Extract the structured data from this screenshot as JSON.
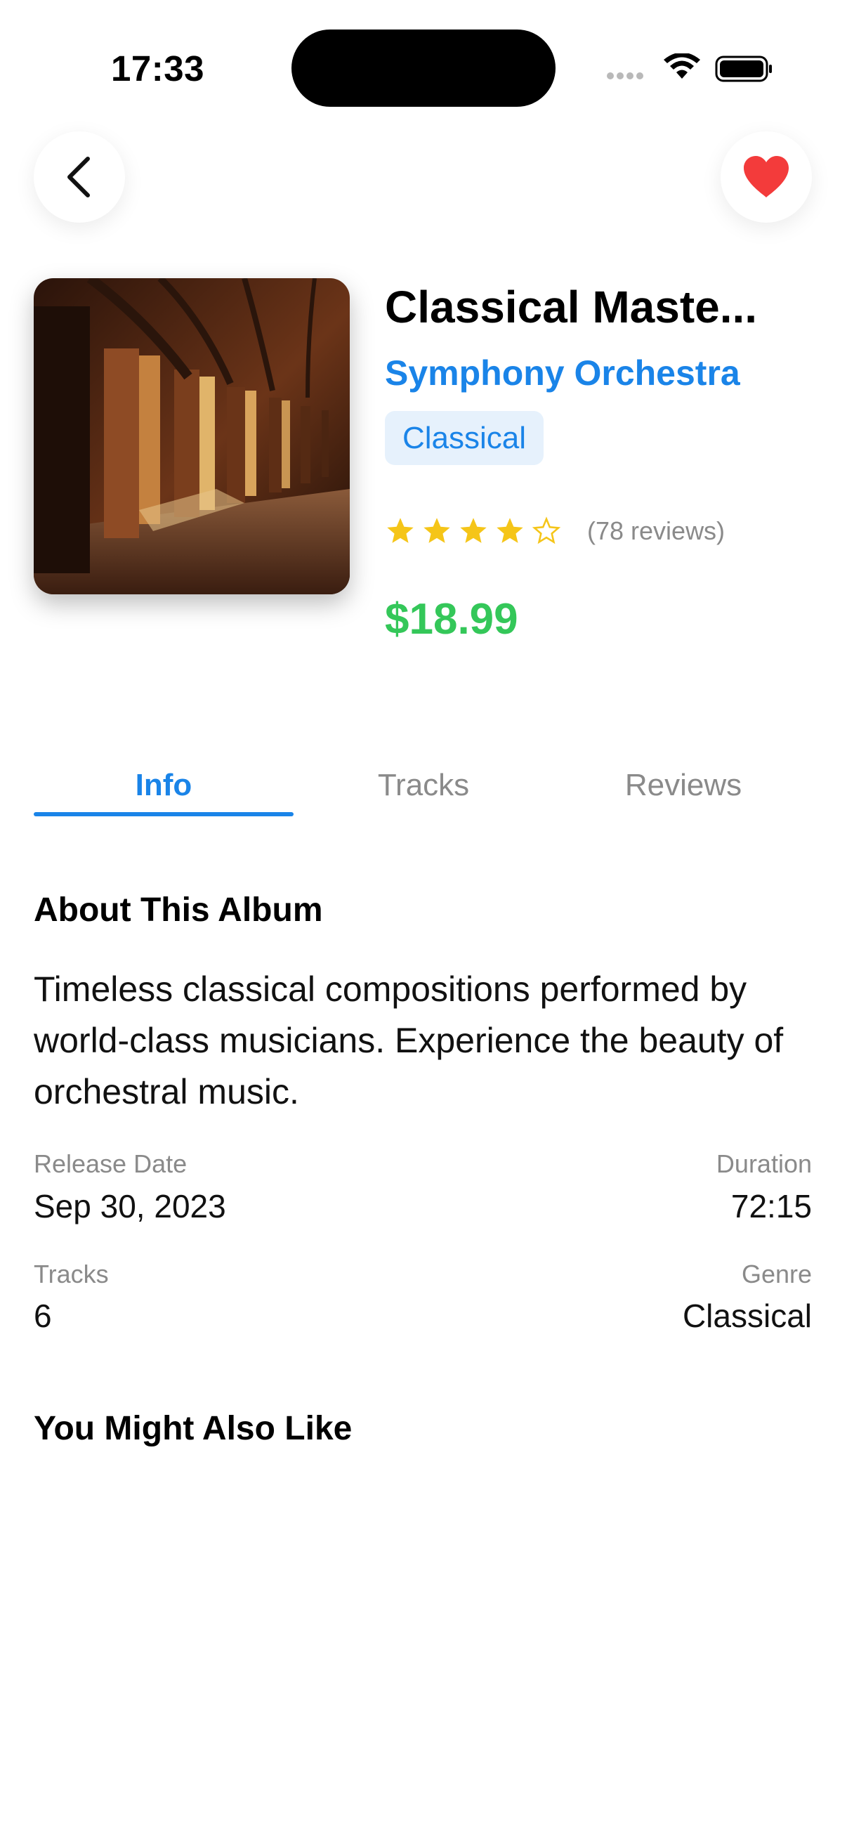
{
  "status_bar": {
    "time": "17:33"
  },
  "album": {
    "title": "Classical Maste...",
    "artist": "Symphony Orchestra",
    "genre_chip": "Classical",
    "rating": 4,
    "rating_max": 5,
    "reviews": "(78 reviews)",
    "price": "$18.99"
  },
  "tabs": [
    {
      "label": "Info",
      "active": true
    },
    {
      "label": "Tracks",
      "active": false
    },
    {
      "label": "Reviews",
      "active": false
    }
  ],
  "info": {
    "about_heading": "About This Album",
    "description": "Timeless classical compositions performed by world-class musicians. Experience the beauty of orchestral music.",
    "release_date_label": "Release Date",
    "release_date": "Sep 30, 2023",
    "duration_label": "Duration",
    "duration": "72:15",
    "tracks_label": "Tracks",
    "tracks": "6",
    "genre_label": "Genre",
    "genre": "Classical"
  },
  "recommendations": {
    "heading": "You Might Also Like"
  },
  "colors": {
    "accent": "#1a84e8",
    "price": "#34c759",
    "favorite": "#f33b3b",
    "star": "#f5c518"
  },
  "icons": [
    "back-chevron-icon",
    "heart-icon",
    "star-icon",
    "wifi-icon",
    "battery-icon",
    "signal-icon"
  ]
}
